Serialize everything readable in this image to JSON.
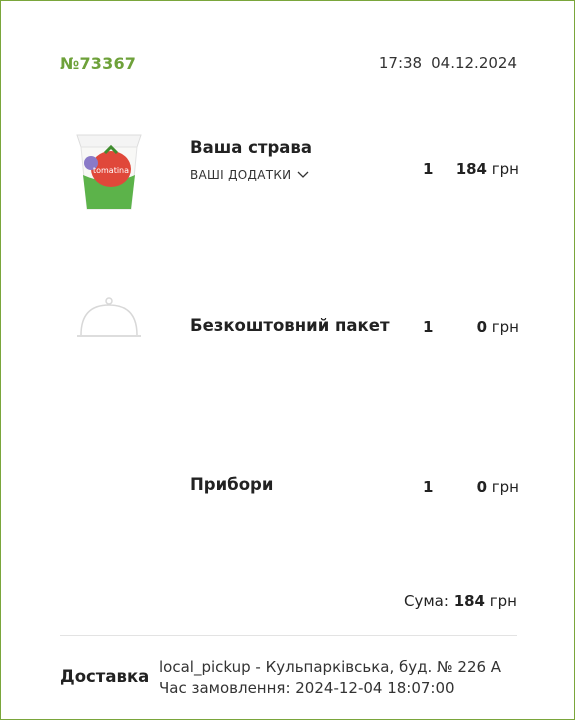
{
  "order": {
    "number": "№73367",
    "time": "17:38",
    "date": "04.12.2024"
  },
  "items": [
    {
      "name": "Ваша страва",
      "addons_label": "ВАШІ ДОДАТКИ",
      "quantity": "1",
      "price": "184",
      "currency": "грн",
      "image": "noodle-box-tomato",
      "cup_text": "tomatina"
    },
    {
      "name": "Безкоштовний пакет",
      "quantity": "1",
      "price": "0",
      "currency": "грн",
      "image": "cloche-icon"
    },
    {
      "name": "Прибори",
      "quantity": "1",
      "price": "0",
      "currency": "грн"
    }
  ],
  "summary": {
    "label": "Сума:",
    "amount": "184",
    "currency": "грн"
  },
  "delivery": {
    "label": "Доставка",
    "line1": "local_pickup - Кульпарківська, буд. № 226 А",
    "line2": "Час замовлення: 2024-12-04 18:07:00"
  },
  "colors": {
    "accent": "#6ea13a",
    "border": "#7aa63b"
  }
}
